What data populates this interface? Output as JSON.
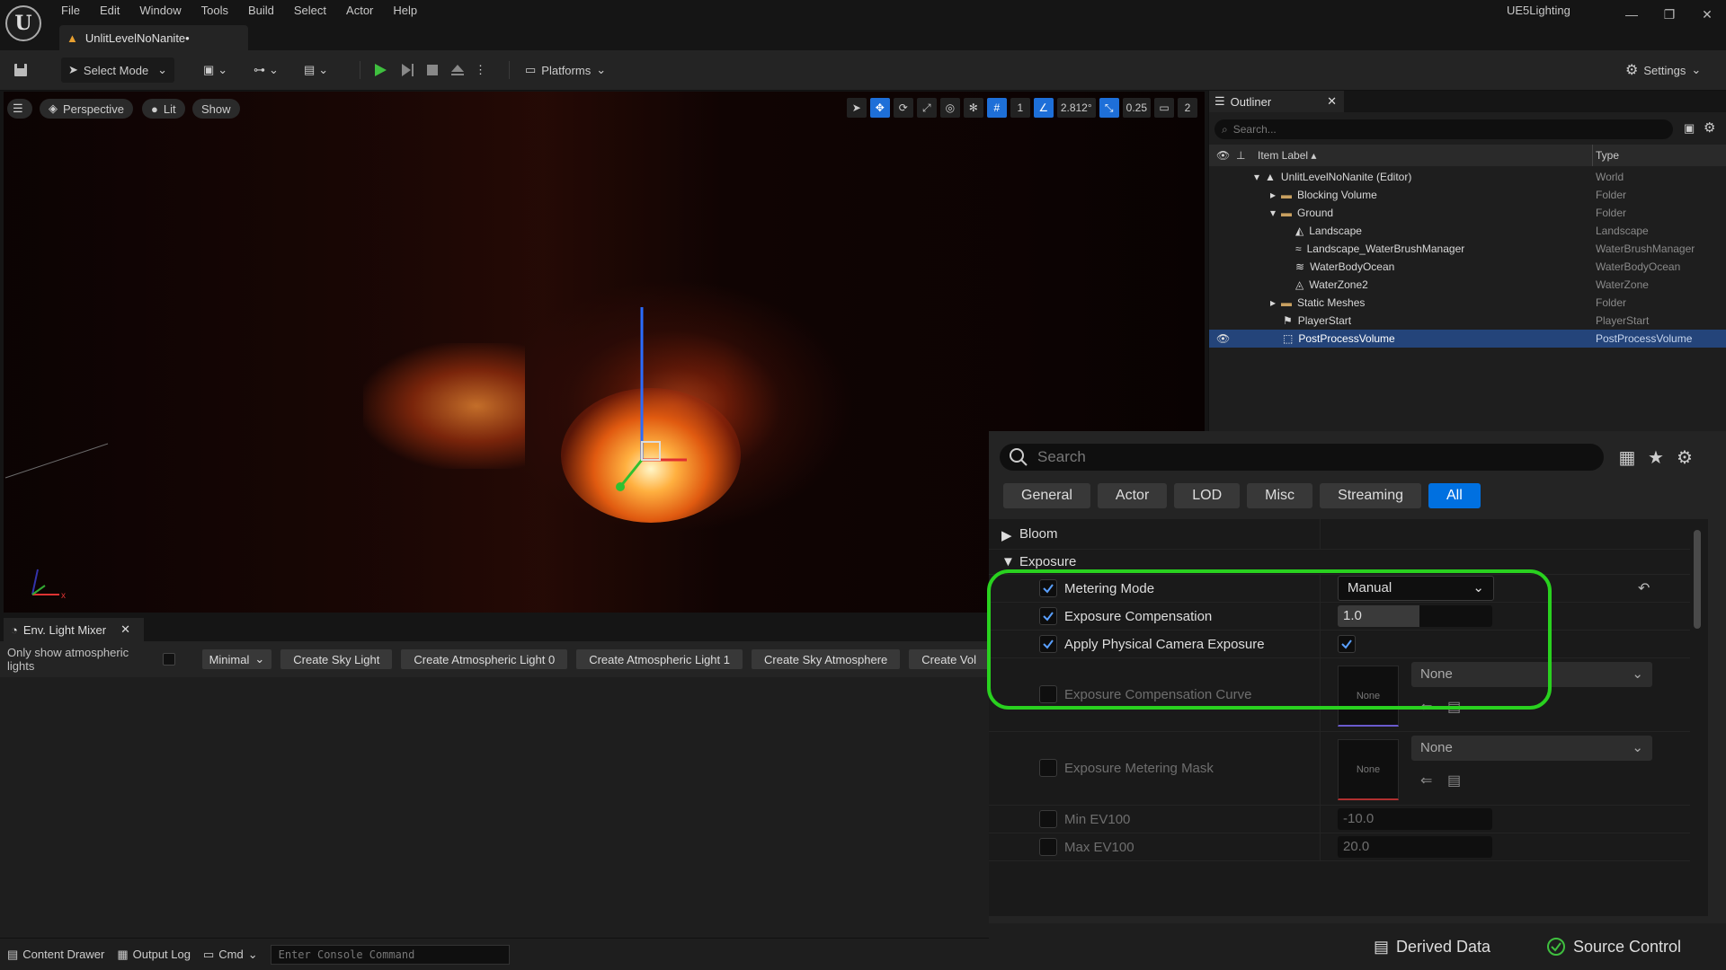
{
  "window": {
    "project_name": "UE5Lighting",
    "doc_tab": "UnlitLevelNoNanite•"
  },
  "menu": [
    "File",
    "Edit",
    "Window",
    "Tools",
    "Build",
    "Select",
    "Actor",
    "Help"
  ],
  "toolbar": {
    "select_mode": "Select Mode",
    "platforms": "Platforms",
    "settings": "Settings"
  },
  "viewport": {
    "perspective": "Perspective",
    "lit": "Lit",
    "show": "Show",
    "grid_value": "1",
    "angle_value": "2.812°",
    "scale_value": "0.25",
    "camera_speed": "2"
  },
  "mixer": {
    "tab": "Env. Light Mixer",
    "only_show_label": "Only show atmospheric lights",
    "mode": "Minimal",
    "buttons": [
      "Create Sky Light",
      "Create Atmospheric Light 0",
      "Create Atmospheric Light 1",
      "Create Sky Atmosphere",
      "Create Vol"
    ]
  },
  "statusbar": {
    "content_drawer": "Content Drawer",
    "output_log": "Output Log",
    "cmd": "Cmd",
    "console_placeholder": "Enter Console Command"
  },
  "outliner": {
    "tab": "Outliner",
    "search_placeholder": "Search...",
    "col_label": "Item Label",
    "col_type": "Type",
    "rows": [
      {
        "label": "UnlitLevelNoNanite (Editor)",
        "type": "World"
      },
      {
        "label": "Blocking Volume",
        "type": "Folder"
      },
      {
        "label": "Ground",
        "type": "Folder"
      },
      {
        "label": "Landscape",
        "type": "Landscape"
      },
      {
        "label": "Landscape_WaterBrushManager",
        "type": "WaterBrushManager"
      },
      {
        "label": "WaterBodyOcean",
        "type": "WaterBodyOcean"
      },
      {
        "label": "WaterZone2",
        "type": "WaterZone"
      },
      {
        "label": "Static Meshes",
        "type": "Folder"
      },
      {
        "label": "PlayerStart",
        "type": "PlayerStart"
      },
      {
        "label": "PostProcessVolume",
        "type": "PostProcessVolume"
      }
    ]
  },
  "details": {
    "search_placeholder": "Search",
    "tabs": [
      "General",
      "Actor",
      "LOD",
      "Misc",
      "Streaming",
      "All"
    ],
    "sections": {
      "bloom": "Bloom",
      "exposure": "Exposure"
    },
    "props": {
      "metering_mode": {
        "label": "Metering Mode",
        "value": "Manual"
      },
      "exposure_comp": {
        "label": "Exposure Compensation",
        "value": "1.0"
      },
      "apply_physical": {
        "label": "Apply Physical Camera Exposure"
      },
      "exposure_comp_curve": {
        "label": "Exposure Compensation Curve",
        "thumb": "None",
        "value": "None"
      },
      "exposure_metering_mask": {
        "label": "Exposure Metering Mask",
        "thumb": "None",
        "value": "None"
      },
      "min_ev100": {
        "label": "Min EV100",
        "value": "-10.0"
      },
      "max_ev100": {
        "label": "Max EV100",
        "value": "20.0"
      }
    }
  },
  "bottom_right": {
    "derived_data": "Derived Data",
    "source_control": "Source Control"
  },
  "colors": {
    "accent": "#0070e0",
    "highlight": "#29d11f",
    "selection": "#24447a"
  }
}
